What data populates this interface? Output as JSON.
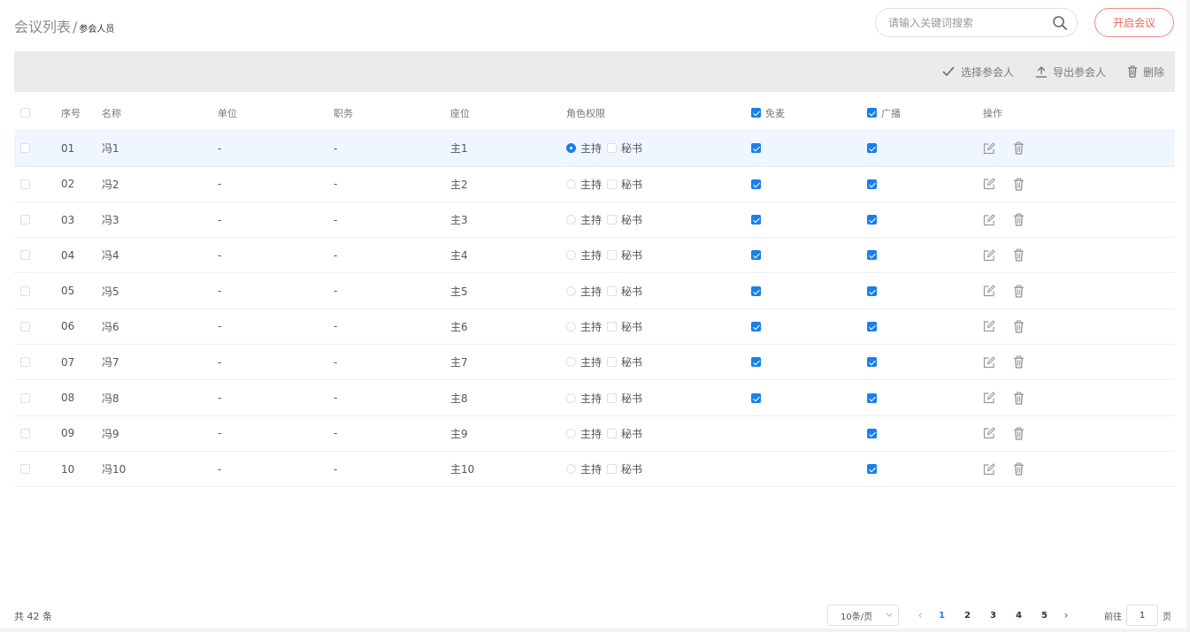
{
  "header": {
    "breadcrumb_main": "会议列表",
    "breadcrumb_sep": "/",
    "breadcrumb_current": "参会人员",
    "search_placeholder": "请输入关键词搜索",
    "start_button": "开启会议"
  },
  "toolbar": {
    "select_label": "选择参会人",
    "export_label": "导出参会人",
    "delete_label": "删除"
  },
  "table": {
    "columns": {
      "no": "序号",
      "name": "名称",
      "unit": "单位",
      "duty": "职务",
      "seat": "座位",
      "role": "角色权限",
      "mic": "免麦",
      "broadcast": "广播",
      "op": "操作"
    },
    "role_options": [
      "主持",
      "秘书"
    ],
    "rows": [
      {
        "no": "01",
        "name": "冯1",
        "unit": "-",
        "duty": "-",
        "seat": "主1",
        "host": true,
        "mic": true,
        "broadcast": true
      },
      {
        "no": "02",
        "name": "冯2",
        "unit": "-",
        "duty": "-",
        "seat": "主2",
        "host": false,
        "mic": true,
        "broadcast": true
      },
      {
        "no": "03",
        "name": "冯3",
        "unit": "-",
        "duty": "-",
        "seat": "主3",
        "host": false,
        "mic": true,
        "broadcast": true
      },
      {
        "no": "04",
        "name": "冯4",
        "unit": "-",
        "duty": "-",
        "seat": "主4",
        "host": false,
        "mic": true,
        "broadcast": true
      },
      {
        "no": "05",
        "name": "冯5",
        "unit": "-",
        "duty": "-",
        "seat": "主5",
        "host": false,
        "mic": true,
        "broadcast": true
      },
      {
        "no": "06",
        "name": "冯6",
        "unit": "-",
        "duty": "-",
        "seat": "主6",
        "host": false,
        "mic": true,
        "broadcast": true
      },
      {
        "no": "07",
        "name": "冯7",
        "unit": "-",
        "duty": "-",
        "seat": "主7",
        "host": false,
        "mic": true,
        "broadcast": true
      },
      {
        "no": "08",
        "name": "冯8",
        "unit": "-",
        "duty": "-",
        "seat": "主8",
        "host": false,
        "mic": true,
        "broadcast": true
      },
      {
        "no": "09",
        "name": "冯9",
        "unit": "-",
        "duty": "-",
        "seat": "主9",
        "host": false,
        "mic": false,
        "broadcast": true
      },
      {
        "no": "10",
        "name": "冯10",
        "unit": "-",
        "duty": "-",
        "seat": "主10",
        "host": false,
        "mic": false,
        "broadcast": true
      }
    ]
  },
  "footer": {
    "total": "共 42 条",
    "page_size": "10条/页",
    "pages": [
      "1",
      "2",
      "3",
      "4",
      "5"
    ],
    "current_page": "1",
    "goto_prefix": "前往",
    "goto_value": "1",
    "goto_suffix": "页"
  },
  "colors": {
    "accent": "#1a7fe8",
    "start_button": "#f0665a",
    "toolbar_bg": "#ebebeb",
    "highlight_row": "#f0f6ff"
  },
  "icons": {
    "search": "search-icon",
    "select": "check-icon",
    "export": "upload-icon",
    "delete": "trash-icon",
    "edit": "edit-icon"
  }
}
